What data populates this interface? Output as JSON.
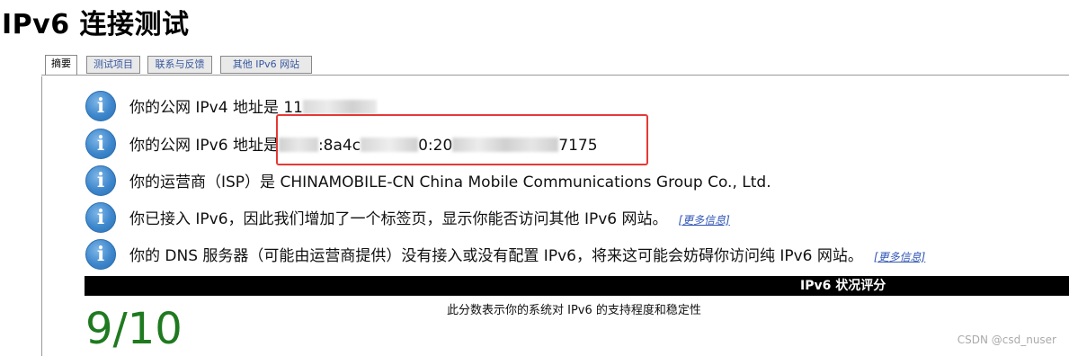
{
  "page": {
    "title": "IPv6 连接测试"
  },
  "tabs": [
    {
      "label": "摘要",
      "active": true
    },
    {
      "label": "测试项目",
      "active": false
    },
    {
      "label": "联系与反馈",
      "active": false
    },
    {
      "label": "其他 IPv6 网站",
      "active": false
    }
  ],
  "info": {
    "ipv4": {
      "label": "你的公网 IPv4 地址是 11",
      "icon": "info-icon"
    },
    "ipv6": {
      "prefix": "你的公网 IPv6 地址是",
      "part1": ":8a4c",
      "part2": "0:20",
      "part3": "7175",
      "icon": "info-icon"
    },
    "isp": {
      "text": "你的运营商（ISP）是 CHINAMOBILE-CN China Mobile Communications Group Co., Ltd.",
      "icon": "info-icon"
    },
    "ipv6_access": {
      "text": "你已接入 IPv6，因此我们增加了一个标签页，显示你能否访问其他 IPv6 网站。",
      "more_link": "[更多信息]",
      "icon": "info-icon"
    },
    "dns": {
      "text": "你的 DNS 服务器（可能由运营商提供）没有接入或没有配置 IPv6，将来这可能会妨碍你访问纯 IPv6 网站。",
      "more_link": "[更多信息]",
      "icon": "info-icon"
    }
  },
  "score": {
    "header": "IPv6 状况评分",
    "description": "此分数表示你的系统对 IPv6 的支持程度和稳定性",
    "value": "9/10"
  },
  "watermark": "CSDN @csd_nuser",
  "colors": {
    "score": "#1f7a1f",
    "highlight": "#e53935",
    "link": "#3156b6",
    "icon": "#3e87cc"
  }
}
